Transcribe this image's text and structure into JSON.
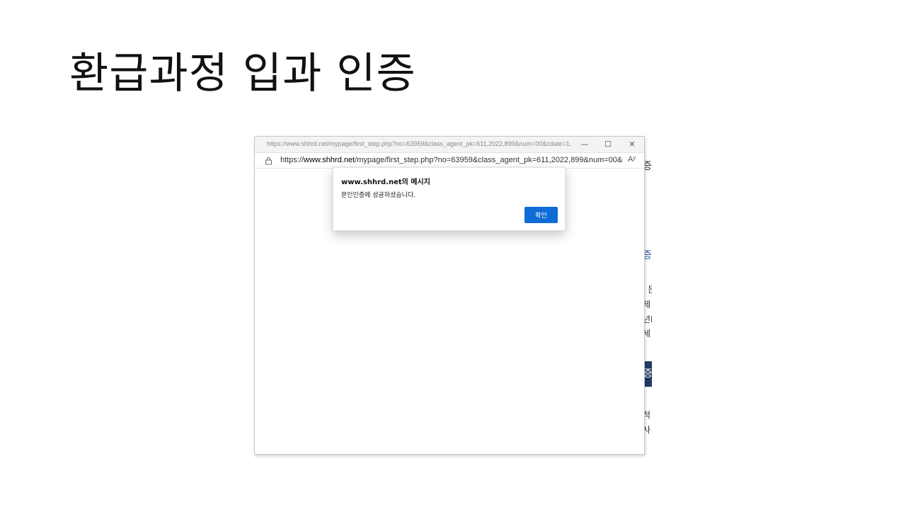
{
  "slide": {
    "title": "환급과정 입과 인증"
  },
  "popup_window": {
    "title_url": "https://www.shhrd.net/mypage/first_step.php?no=63959&class_agent_pk=611,2022,899&num=00&cdate=1...",
    "controls": {
      "minimize": "—",
      "maximize": "☐",
      "close": "✕"
    },
    "address": {
      "scheme": "https://",
      "host": "www.shhrd.net",
      "path": "/mypage/first_step.php?no=63959&class_agent_pk=611,2022,899&num=00&cdat...",
      "read_aloud": "Aʸ"
    }
  },
  "dialog": {
    "title": "www.shhrd.net의 메시지",
    "message": "본인인증에 성공하셨습니다.",
    "ok_label": "확인"
  },
  "background_page": {
    "fragments": [
      "증",
      "증",
      "l 든",
      "제",
      "년E",
      "세 곤",
      "증",
      "적",
      "사"
    ]
  },
  "colors": {
    "accent_button": "#0f6cd6",
    "bg_button": "#1f3b66"
  }
}
